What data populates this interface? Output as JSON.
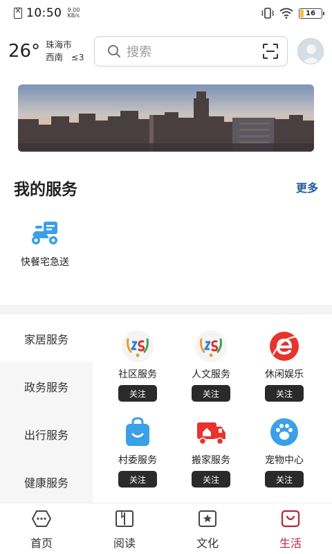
{
  "status_bar": {
    "time": "10:50",
    "net_speed_value": "9.00",
    "net_speed_unit": "KB/s",
    "battery": "16",
    "battery_level_percent": 16
  },
  "weather": {
    "temperature": "26°",
    "city": "珠海市",
    "wind_direction": "西南",
    "wind_level": "≤3"
  },
  "search": {
    "placeholder": "搜索"
  },
  "my_services": {
    "title": "我的服务",
    "more": "更多",
    "items": [
      {
        "label": "快餐宅急送",
        "icon": "delivery-scooter-icon"
      }
    ]
  },
  "categories": [
    {
      "label": "家居服务",
      "active": true
    },
    {
      "label": "政务服务",
      "active": false
    },
    {
      "label": "出行服务",
      "active": false
    },
    {
      "label": "健康服务",
      "active": false
    }
  ],
  "services": [
    {
      "label": "社区服务",
      "button": "关注",
      "icon": "community-logo-icon"
    },
    {
      "label": "人文服务",
      "button": "关注",
      "icon": "community-logo-icon"
    },
    {
      "label": "休闲娱乐",
      "button": "关注",
      "icon": "browser-e-icon"
    },
    {
      "label": "村委服务",
      "button": "关注",
      "icon": "shopping-bag-icon"
    },
    {
      "label": "搬家服务",
      "button": "关注",
      "icon": "moving-truck-icon"
    },
    {
      "label": "宠物中心",
      "button": "关注",
      "icon": "paw-icon"
    }
  ],
  "bottom_nav": [
    {
      "label": "首页",
      "icon": "home-icon",
      "active": false
    },
    {
      "label": "阅读",
      "icon": "book-icon",
      "active": false
    },
    {
      "label": "文化",
      "icon": "star-badge-icon",
      "active": false
    },
    {
      "label": "生活",
      "icon": "life-icon",
      "active": true
    }
  ],
  "colors": {
    "accent": "#b3263a",
    "link": "#1f5a9b",
    "button_bg": "#2a2a2a",
    "delivery_blue": "#3aa0e8"
  }
}
